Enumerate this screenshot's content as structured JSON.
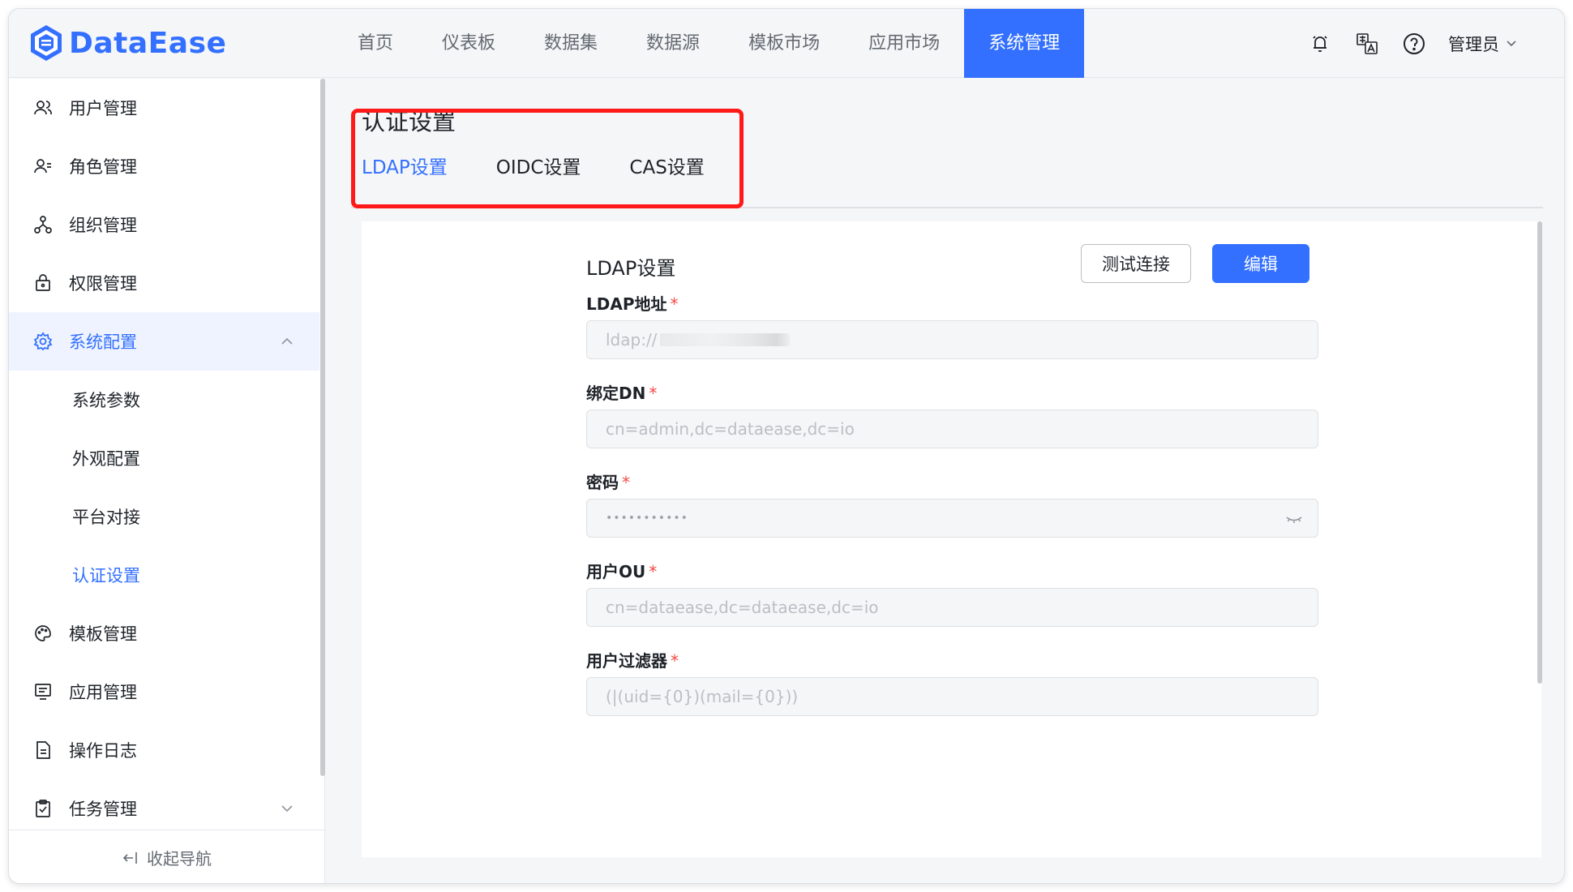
{
  "header": {
    "logo_text": "DataEase",
    "nav": [
      {
        "label": "首页",
        "active": false
      },
      {
        "label": "仪表板",
        "active": false
      },
      {
        "label": "数据集",
        "active": false
      },
      {
        "label": "数据源",
        "active": false
      },
      {
        "label": "模板市场",
        "active": false
      },
      {
        "label": "应用市场",
        "active": false
      },
      {
        "label": "系统管理",
        "active": true
      }
    ],
    "icons": [
      "bell-icon",
      "translate-icon",
      "help-icon"
    ],
    "user": "管理员"
  },
  "sidebar": {
    "items": [
      {
        "label": "用户管理",
        "icon": "user-icon"
      },
      {
        "label": "角色管理",
        "icon": "role-icon"
      },
      {
        "label": "组织管理",
        "icon": "org-icon"
      },
      {
        "label": "权限管理",
        "icon": "lock-icon"
      },
      {
        "label": "系统配置",
        "icon": "gear-icon",
        "expanded": true
      },
      {
        "label": "模板管理",
        "icon": "palette-icon"
      },
      {
        "label": "应用管理",
        "icon": "monitor-icon"
      },
      {
        "label": "操作日志",
        "icon": "log-icon"
      },
      {
        "label": "任务管理",
        "icon": "clipboard-icon",
        "expanded": false
      }
    ],
    "sub_items": [
      {
        "label": "系统参数",
        "active": false
      },
      {
        "label": "外观配置",
        "active": false
      },
      {
        "label": "平台对接",
        "active": false
      },
      {
        "label": "认证设置",
        "active": true
      }
    ],
    "collapse_label": "收起导航"
  },
  "main": {
    "title": "认证设置",
    "tabs": [
      {
        "label": "LDAP设置",
        "active": true
      },
      {
        "label": "OIDC设置",
        "active": false
      },
      {
        "label": "CAS设置",
        "active": false
      }
    ],
    "form": {
      "title": "LDAP设置",
      "test_button": "测试连接",
      "edit_button": "编辑",
      "fields": [
        {
          "label": "LDAP地址",
          "required": "*",
          "value": "ldap://"
        },
        {
          "label": "绑定DN",
          "required": "*",
          "value": "cn=admin,dc=dataease,dc=io"
        },
        {
          "label": "密码",
          "required": "*",
          "value": "•••••••••••"
        },
        {
          "label": "用户OU",
          "required": "*",
          "value": "cn=dataease,dc=dataease,dc=io"
        },
        {
          "label": "用户过滤器",
          "required": "*",
          "value": "(|(uid={0})(mail={0}))"
        }
      ]
    }
  },
  "colors": {
    "accent": "#3370ff",
    "required": "#f54a45",
    "highlight": "#ff1a1a"
  }
}
